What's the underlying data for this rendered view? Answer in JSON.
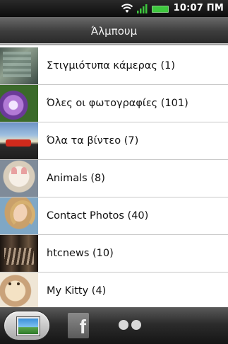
{
  "status_bar": {
    "time": "10:07 ΠΜ",
    "icons": [
      "wifi-icon",
      "signal-icon",
      "battery-icon"
    ],
    "battery_color": "#3ec83e"
  },
  "header": {
    "title": "Άλμπουμ"
  },
  "albums": [
    {
      "label": "Στιγμιότυπα κάμερας (1)",
      "thumb": "camera-shots-thumbnail"
    },
    {
      "label": "Όλες οι φωτογραφίες (101)",
      "thumb": "all-photos-thumbnail"
    },
    {
      "label": "Όλα τα βίντεο (7)",
      "thumb": "all-videos-thumbnail"
    },
    {
      "label": "Animals (8)",
      "thumb": "animals-thumbnail"
    },
    {
      "label": "Contact Photos (40)",
      "thumb": "contact-photos-thumbnail"
    },
    {
      "label": "htcnews (10)",
      "thumb": "htcnews-thumbnail"
    },
    {
      "label": "My Kitty (4)",
      "thumb": "my-kitty-thumbnail"
    }
  ],
  "tabs": {
    "items": [
      "albums-tab",
      "facebook-tab",
      "more-tab"
    ],
    "selected": "albums-tab",
    "facebook_glyph": "f"
  }
}
